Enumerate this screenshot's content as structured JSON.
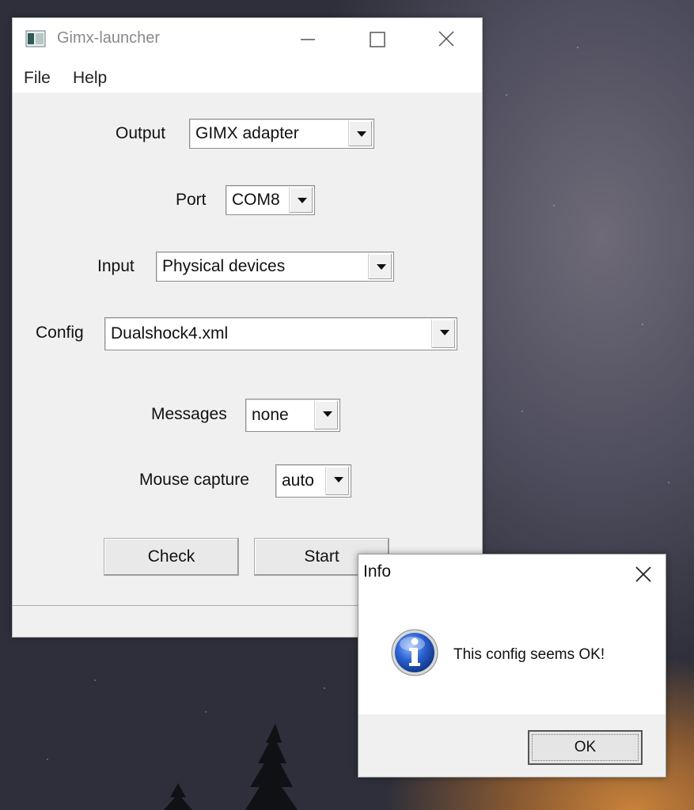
{
  "window": {
    "title": "Gimx-launcher",
    "menu": [
      "File",
      "Help"
    ]
  },
  "form": {
    "output": {
      "label": "Output",
      "value": "GIMX adapter"
    },
    "port": {
      "label": "Port",
      "value": "COM8"
    },
    "input": {
      "label": "Input",
      "value": "Physical devices"
    },
    "config": {
      "label": "Config",
      "value": "Dualshock4.xml"
    },
    "messages": {
      "label": "Messages",
      "value": "none"
    },
    "mouse_capture": {
      "label": "Mouse capture",
      "value": "auto"
    }
  },
  "buttons": {
    "check": "Check",
    "start": "Start"
  },
  "dialog": {
    "title": "Info",
    "message": "This config seems OK!",
    "ok": "OK",
    "icon": "info-icon"
  },
  "colors": {
    "dialog_icon_blue": "#1f5fbf",
    "window_bg": "#f0f0f0"
  }
}
